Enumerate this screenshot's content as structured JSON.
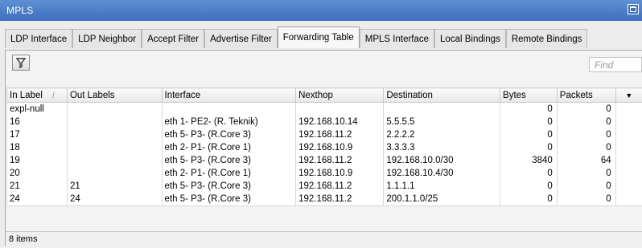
{
  "window": {
    "title": "MPLS"
  },
  "tabs": [
    {
      "label": "LDP Interface"
    },
    {
      "label": "LDP Neighbor"
    },
    {
      "label": "Accept Filter"
    },
    {
      "label": "Advertise Filter"
    },
    {
      "label": "Forwarding Table",
      "active": true
    },
    {
      "label": "MPLS Interface"
    },
    {
      "label": "Local Bindings"
    },
    {
      "label": "Remote Bindings"
    }
  ],
  "toolbar": {
    "filter_icon": "filter-icon",
    "find_placeholder": "Find"
  },
  "table": {
    "columns": [
      "In Label",
      "Out Labels",
      "Interface",
      "Nexthop",
      "Destination",
      "Bytes",
      "Packets"
    ],
    "sort_column": "In Label",
    "sort_indicator": "/",
    "rows": [
      {
        "in_label": "expl-null",
        "out_labels": "",
        "interface": "",
        "nexthop": "",
        "destination": "",
        "bytes": "0",
        "packets": "0"
      },
      {
        "in_label": "16",
        "out_labels": "",
        "interface": "eth 1- PE2- (R. Teknik)",
        "nexthop": "192.168.10.14",
        "destination": "5.5.5.5",
        "bytes": "0",
        "packets": "0"
      },
      {
        "in_label": "17",
        "out_labels": "",
        "interface": "eth 5- P3- (R.Core 3)",
        "nexthop": "192.168.11.2",
        "destination": "2.2.2.2",
        "bytes": "0",
        "packets": "0"
      },
      {
        "in_label": "18",
        "out_labels": "",
        "interface": "eth 2- P1- (R.Core 1)",
        "nexthop": "192.168.10.9",
        "destination": "3.3.3.3",
        "bytes": "0",
        "packets": "0"
      },
      {
        "in_label": "19",
        "out_labels": "",
        "interface": "eth 5- P3- (R.Core 3)",
        "nexthop": "192.168.11.2",
        "destination": "192.168.10.0/30",
        "bytes": "3840",
        "packets": "64"
      },
      {
        "in_label": "20",
        "out_labels": "",
        "interface": "eth 2- P1- (R.Core 1)",
        "nexthop": "192.168.10.9",
        "destination": "192.168.10.4/30",
        "bytes": "0",
        "packets": "0"
      },
      {
        "in_label": "21",
        "out_labels": "21",
        "interface": "eth 5- P3- (R.Core 3)",
        "nexthop": "192.168.11.2",
        "destination": "1.1.1.1",
        "bytes": "0",
        "packets": "0"
      },
      {
        "in_label": "24",
        "out_labels": "24",
        "interface": "eth 5- P3- (R.Core 3)",
        "nexthop": "192.168.11.2",
        "destination": "200.1.1.0/25",
        "bytes": "0",
        "packets": "0"
      }
    ]
  },
  "status": {
    "items_text": "8 items"
  }
}
